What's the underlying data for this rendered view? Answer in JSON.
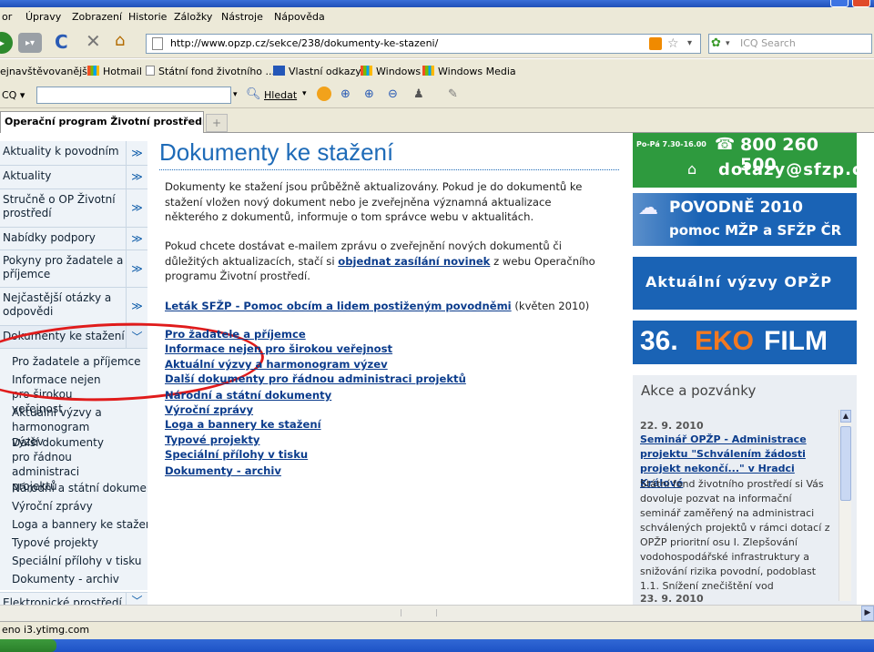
{
  "browser": {
    "menu": [
      "or",
      "Úpravy",
      "Zobrazení",
      "Historie",
      "Záložky",
      "Nástroje",
      "Nápověda"
    ],
    "url": "http://www.opzp.cz/sekce/238/dokumenty-ke-stazeni/",
    "search_placeholder": "ICQ Search",
    "bookmarks": [
      "ejnavštěvovanější",
      "Hotmail",
      "Státní fond životního ...",
      "Vlastní odkazy",
      "Windows",
      "Windows Media"
    ],
    "icq_label": "CQ",
    "find_label": "Hledat",
    "tab_title": "Operační program Životní prostředí -...",
    "new_tab": "+",
    "status": "eno i3.ytimg.com"
  },
  "sidebar": {
    "items": [
      {
        "label": "Aktuality k povodním",
        "chev": "≫"
      },
      {
        "label": "Aktuality",
        "chev": "≫"
      },
      {
        "label": "Stručně o OP Životní prostředí",
        "chev": "≫"
      },
      {
        "label": "Nabídky podpory",
        "chev": "≫"
      },
      {
        "label": "Pokyny pro žadatele a příjemce",
        "chev": "≫"
      },
      {
        "label": "Nejčastější otázky a odpovědi",
        "chev": "≫"
      },
      {
        "label": "Dokumenty ke stažení",
        "chev": "﹀"
      }
    ],
    "sub": [
      "Pro žadatele a příjemce",
      "Informace nejen pro širokou veřejnost",
      "Aktuální výzvy a harmonogram výzev",
      "Další dokumenty pro řádnou administraci projektů",
      "Národní a státní dokumenty",
      "Výroční zprávy",
      "Loga a bannery ke stažení",
      "Typové projekty",
      "Speciální přílohy v tisku",
      "Dokumenty - archiv"
    ],
    "last_item": "Elektronické prostředí"
  },
  "main": {
    "title": "Dokumenty ke stažení",
    "p1": "Dokumenty ke stažení jsou průběžně aktualizovány. Pokud je do dokumentů ke stažení vložen nový dokument nebo je zveřejněna významná aktualizace některého z dokumentů, informuje o tom správce webu v aktualitách.",
    "p2_a": "Pokud chcete dostávat e-mailem zprávu o zveřejnění nových dokumentů či důležitých aktualizacích, stačí si ",
    "p2_link": "objednat zasílání novinek",
    "p2_b": " z webu Operačního programu Životní prostředí.",
    "leaflet_link": "Leták SFŽP - Pomoc obcím a lidem postiženým povodněmi",
    "leaflet_date": " (květen 2010)",
    "links": [
      "Pro žadatele a příjemce",
      "Informace nejen pro širokou veřejnost",
      "Aktuální výzvy a harmonogram výzev",
      "Další dokumenty pro řádnou administraci projektů",
      "Národní a státní dokumenty",
      "Výroční zprávy",
      "Loga a bannery ke stažení",
      "Typové projekty",
      "Speciální přílohy v tisku",
      "Dokumenty - archiv"
    ]
  },
  "right": {
    "hotline_hours": "Po-Pá 7.30-16.00",
    "hotline_phone": "800 260 500",
    "email": "dotazy@sfzp.cz",
    "flood_title": "POVODNĚ 2010",
    "flood_sub": "pomoc MŽP a SFŽP ČR",
    "calls": "Aktuální výzvy OPŽP",
    "ekofilm_num": "36.",
    "ekofilm_eko": "EKO",
    "ekofilm_film": "FILM",
    "akce_title": "Akce a pozvánky",
    "event1_date": "22. 9. 2010",
    "event1_title": "Seminář OPŽP - Administrace projektu \"Schválením žádosti projekt nekončí...\" v Hradci Králové",
    "event1_text": "Státní fond životního prostředí si Vás dovoluje pozvat na informační seminář zaměřený na administraci schválených projektů v rámci dotací z OPŽP prioritní osu I. Zlepšování vodohospodářské infrastruktury a snižování rizika povodní, podoblast 1.1. Snížení znečištění vod",
    "event2_date": "23. 9. 2010"
  },
  "colors": {
    "title_blue": "#1e6bb8",
    "link_blue": "#0b3c8c",
    "hotline_green": "#2e9a3e",
    "banner_blue": "#1a63b5",
    "annotation_red": "#e01b1b"
  }
}
